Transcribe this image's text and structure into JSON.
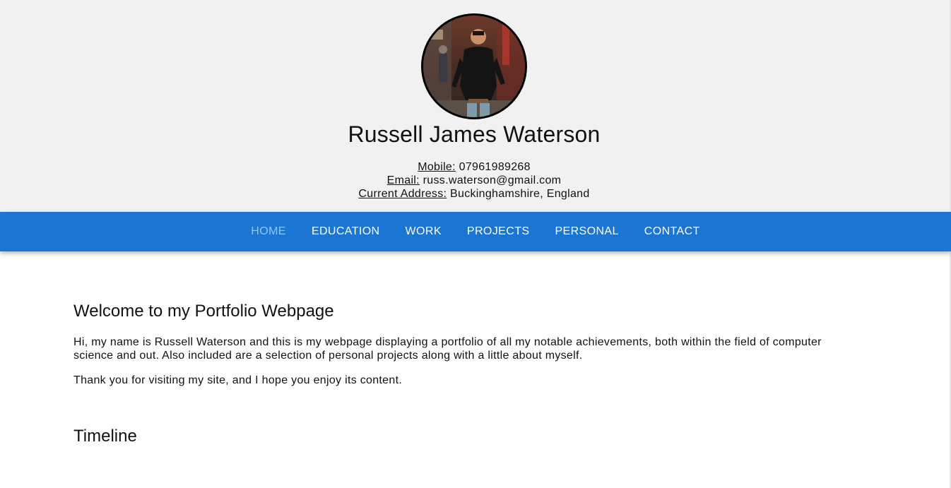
{
  "profile": {
    "name": "Russell James Waterson",
    "contact": [
      {
        "label": "Mobile:",
        "value": "07961989268"
      },
      {
        "label": "Email:",
        "value": "russ.waterson@gmail.com"
      },
      {
        "label": "Current Address:",
        "value": "Buckinghamshire, England"
      }
    ]
  },
  "nav": {
    "items": [
      "HOME",
      "EDUCATION",
      "WORK",
      "PROJECTS",
      "PERSONAL",
      "CONTACT"
    ],
    "active": "HOME",
    "bg_color": "#1a76d2",
    "active_color": "#90c6f5"
  },
  "main": {
    "welcome_title": "Welcome to my Portfolio Webpage",
    "intro": "Hi, my name is Russell Waterson and this is my webpage displaying a portfolio of all my notable achievements, both within the field of computer science and out. Also included are a selection of personal projects along with a little about myself.",
    "thanks": "Thank you for visiting my site, and I hope you enjoy its content.",
    "timeline_title": "Timeline"
  },
  "colors": {
    "header_bg": "#f1f1f1"
  }
}
